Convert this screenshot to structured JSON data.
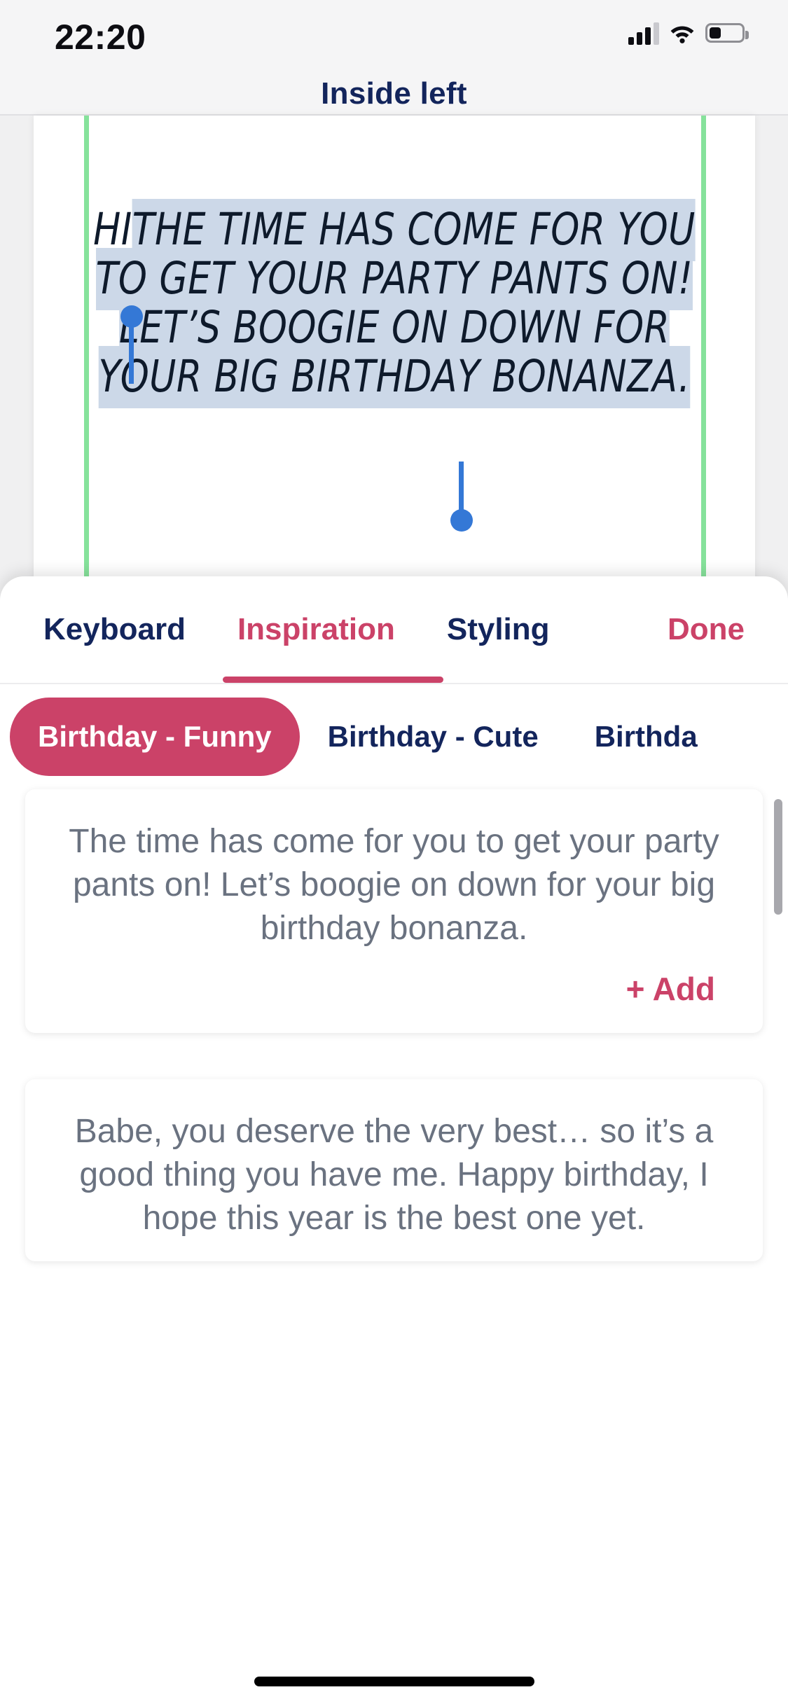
{
  "status_bar": {
    "time": "22:20",
    "cellular_icon": "cellular-bars-icon",
    "wifi_icon": "wifi-icon",
    "battery_icon": "battery-icon",
    "battery_level_percent": 32
  },
  "nav": {
    "title": "Inside left"
  },
  "card_editor": {
    "unselected_prefix": "HI",
    "selected_text": "THE TIME HAS COME FOR YOU TO GET YOUR PARTY PANTS ON! LET’S BOOGIE ON DOWN FOR YOUR BIG BIRTHDAY BONANZA.",
    "full_text": "HITHE TIME HAS COME FOR YOU TO GET YOUR PARTY PANTS ON! LET’S BOOGIE ON DOWN FOR YOUR BIG BIRTHDAY BONANZA.",
    "selection_highlight_color": "#ccd8e8",
    "handle_color": "#3478d6",
    "guide_line_color": "#86e29b"
  },
  "sheet": {
    "tabs": [
      {
        "label": "Keyboard",
        "active": false
      },
      {
        "label": "Inspiration",
        "active": true
      },
      {
        "label": "Styling",
        "active": false
      },
      {
        "label": "Done",
        "active": false,
        "accent": true
      }
    ],
    "chips": [
      {
        "label": "Birthday - Funny",
        "active": true
      },
      {
        "label": "Birthday - Cute",
        "active": false
      },
      {
        "label": "Birthda",
        "active": false
      }
    ],
    "suggestions": [
      {
        "text": "The time has come for you to get your party pants on! Let’s boogie on down for your big birthday bonanza.",
        "add_label": "+ Add"
      },
      {
        "text": "Babe, you deserve the very best… so it’s a good thing you have me. Happy birthday, I hope this year is the best one yet."
      }
    ]
  },
  "colors": {
    "accent": "#cb4268",
    "navy": "#13255c",
    "body_text": "#6a7280",
    "green_guide": "#86e29b",
    "selection_blue": "#3478d6"
  }
}
